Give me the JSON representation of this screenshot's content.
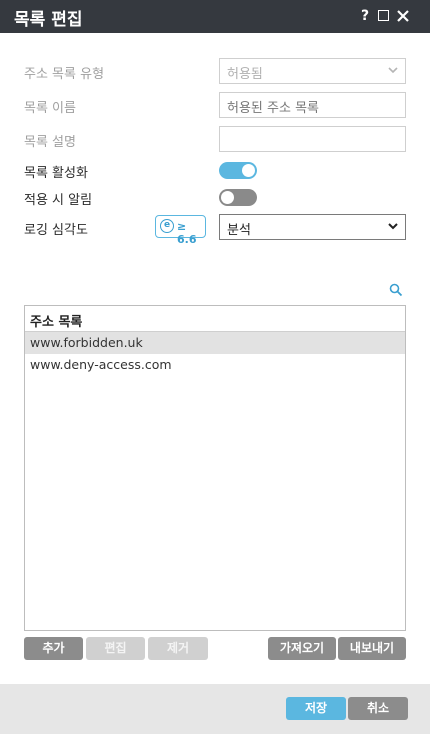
{
  "window": {
    "title": "목록 편집",
    "help_label": "?"
  },
  "form": {
    "type_label": "주소 목록 유형",
    "type_value": "허용됨",
    "name_label": "목록 이름",
    "name_value": "허용된 주소 목록",
    "desc_label": "목록 설명",
    "desc_value": "",
    "activate_label": "목록 활성화",
    "activate_on": true,
    "notify_label": "적용 시 알림",
    "notify_on": false,
    "log_label": "로깅 심각도",
    "log_version_badge": "≥ 6.6",
    "log_version_icon": "e",
    "log_value": "분석"
  },
  "list": {
    "header": "주소 목록",
    "items": [
      {
        "label": "www.forbidden.uk",
        "selected": true
      },
      {
        "label": "www.deny-access.com",
        "selected": false
      }
    ]
  },
  "list_buttons": {
    "add": "추가",
    "edit": "편집",
    "remove": "제거",
    "import": "가져오기",
    "export": "내보내기"
  },
  "footer": {
    "save": "저장",
    "cancel": "취소"
  },
  "colors": {
    "titlebar": "#35393f",
    "accent": "#5bb7e0",
    "button_gray": "#8c8c8c",
    "footer_bg": "#e6e6e6"
  }
}
